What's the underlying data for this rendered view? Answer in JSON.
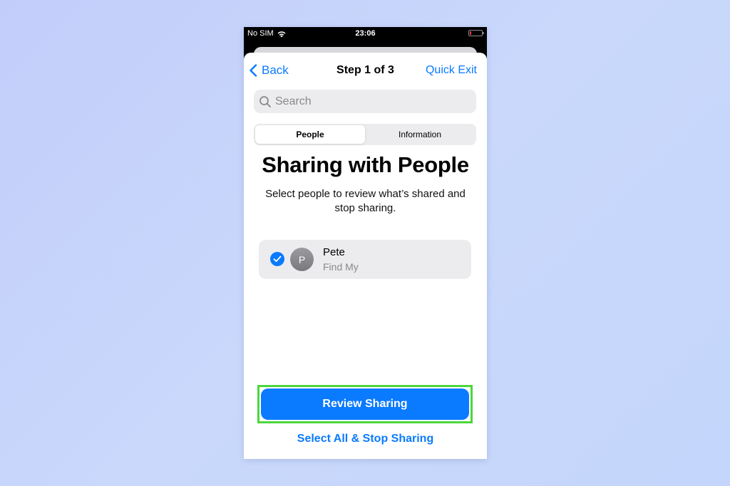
{
  "status_bar": {
    "carrier": "No SIM",
    "time": "23:06",
    "wifi_icon": "wifi-icon",
    "battery_icon": "battery-low-icon",
    "battery_color": "#ff3b30"
  },
  "nav": {
    "back_label": "Back",
    "title": "Step 1 of 3",
    "quick_exit_label": "Quick Exit"
  },
  "search": {
    "placeholder": "Search",
    "value": "",
    "icon": "search-icon"
  },
  "segments": [
    {
      "label": "People",
      "selected": true
    },
    {
      "label": "Information",
      "selected": false
    }
  ],
  "main": {
    "heading": "Sharing with People",
    "subtitle": "Select people to review what’s shared and stop sharing."
  },
  "people": [
    {
      "initial": "P",
      "name": "Pete",
      "source": "Find My",
      "checked": true
    }
  ],
  "actions": {
    "primary_label": "Review Sharing",
    "secondary_label": "Select All & Stop Sharing"
  },
  "colors": {
    "accent": "#0a7aff",
    "highlight": "#4cd63c",
    "background": "#c6d3fb"
  }
}
